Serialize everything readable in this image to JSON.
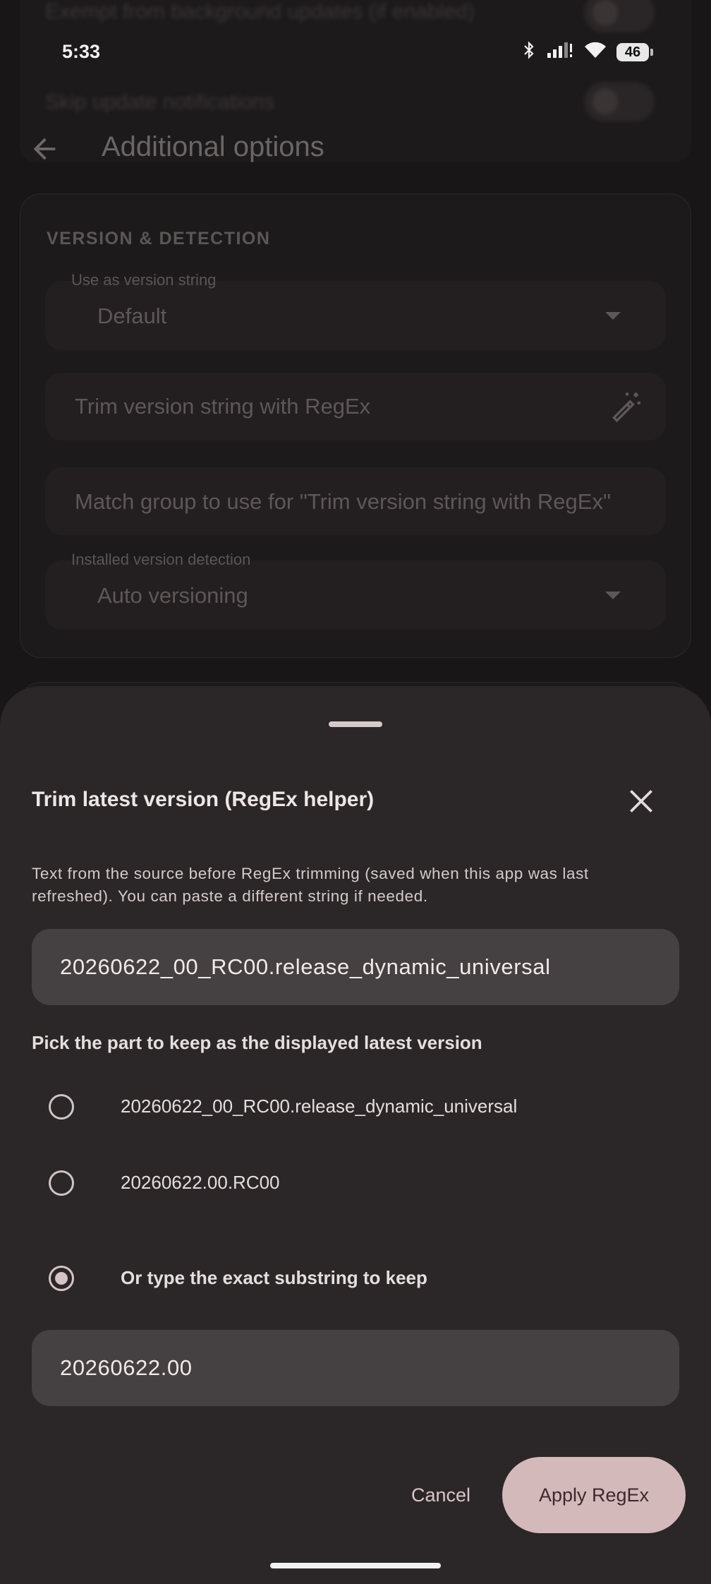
{
  "status_bar": {
    "time": "5:33",
    "battery": "46"
  },
  "background": {
    "blurred_rows": [
      "Exempt from background updates (if enabled)",
      "Skip update notifications"
    ],
    "app_bar_title": "Additional options",
    "section_title": "VERSION & DETECTION",
    "version_string_label": "Use as version string",
    "version_string_value": "Default",
    "trim_placeholder": "Trim version string with RegEx",
    "match_group_placeholder": "Match group to use for \"Trim version string with RegEx\"",
    "detection_label": "Installed version detection",
    "detection_value": "Auto versioning"
  },
  "sheet": {
    "title": "Trim latest version (RegEx helper)",
    "description": "Text from the source before RegEx trimming (saved when this app was last refreshed). You can paste a different string if needed.",
    "source_text": "20260622_00_RC00.release_dynamic_universal",
    "pick_label": "Pick the part to keep as the displayed latest version",
    "options": [
      {
        "label": "20260622_00_RC00.release_dynamic_universal",
        "selected": false
      },
      {
        "label": "20260622.00.RC00",
        "selected": false
      },
      {
        "label": "Or type the exact substring to keep",
        "selected": true
      }
    ],
    "custom_substring": "20260622.00",
    "cancel_label": "Cancel",
    "apply_label": "Apply RegEx"
  },
  "colors": {
    "sheet_bg": "#2b2627",
    "primary": "#d4b9bb",
    "field_bg": "#454041"
  }
}
